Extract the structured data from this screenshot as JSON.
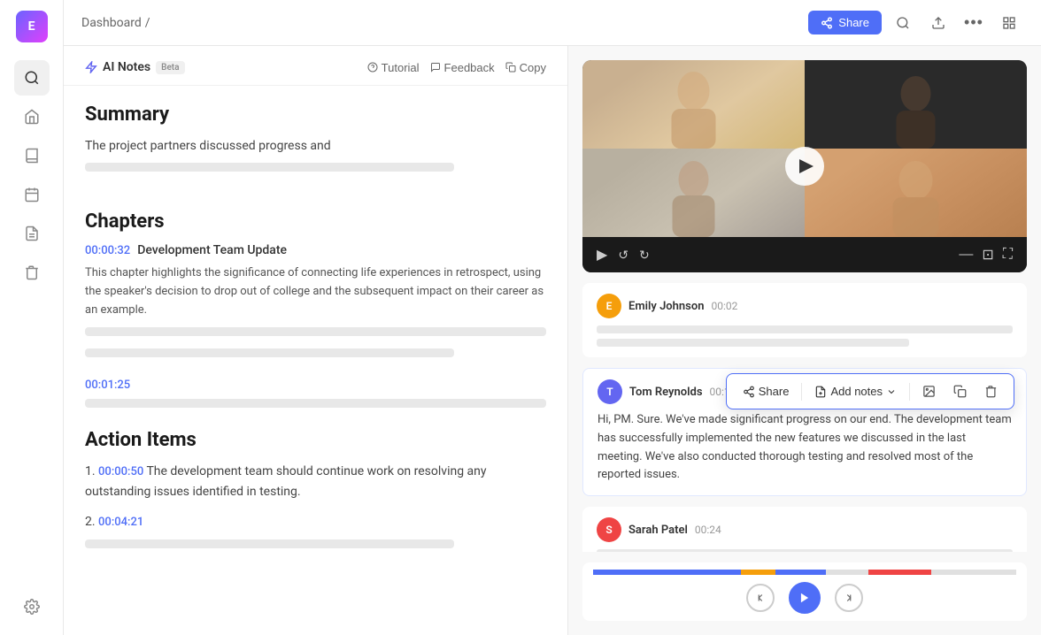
{
  "app": {
    "logo_text": "E"
  },
  "breadcrumb": {
    "text": "Dashboard",
    "separator": "/"
  },
  "topbar": {
    "share_label": "Share",
    "search_tooltip": "Search",
    "upload_tooltip": "Upload",
    "more_tooltip": "More",
    "layout_tooltip": "Layout"
  },
  "notes_panel": {
    "title": "AI Notes",
    "beta_label": "Beta",
    "tutorial_label": "Tutorial",
    "feedback_label": "Feedback",
    "copy_label": "Copy",
    "summary_title": "Summary",
    "summary_text": "The  project partners discussed progress and",
    "chapters_title": "Chapters",
    "chapter1": {
      "timestamp": "00:00:32",
      "title": "Development Team Update",
      "description": "This chapter highlights the significance of connecting life experiences in retrospect, using the speaker's decision to drop out of college and the subsequent impact on their career as an example."
    },
    "chapter2": {
      "timestamp": "00:01:25"
    },
    "action_items_title": "Action Items",
    "action1_timestamp": "00:00:50",
    "action1_text": "The development team should continue work on resolving any outstanding issues identified in testing.",
    "action2_timestamp": "00:04:21"
  },
  "comments": [
    {
      "name": "Emily Johnson",
      "time": "00:02",
      "avatar_color": "#f59e0b",
      "avatar_initial": "E",
      "has_text": false
    },
    {
      "name": "Tom Reynolds",
      "time": "00:11",
      "avatar_color": "#6366f1",
      "avatar_initial": "T",
      "text": "Hi, PM. Sure. We've made significant progress on our end. The development team has successfully implemented the new features we discussed in the last meeting. We've also conducted thorough testing and resolved most of the reported issues."
    },
    {
      "name": "Sarah Patel",
      "time": "00:24",
      "avatar_color": "#ef4444",
      "avatar_initial": "S",
      "has_text": false
    }
  ],
  "action_toolbar": {
    "share_label": "Share",
    "add_notes_label": "Add notes",
    "image_tooltip": "Image",
    "copy_tooltip": "Copy",
    "delete_tooltip": "Delete"
  },
  "progress_segments": [
    {
      "color": "#4f6ef7",
      "width": "35%"
    },
    {
      "color": "#f59e0b",
      "width": "8%"
    },
    {
      "color": "#4f6ef7",
      "width": "12%"
    },
    {
      "color": "#e8e8e8",
      "width": "10%"
    },
    {
      "color": "#ef4444",
      "width": "15%"
    },
    {
      "color": "#e8e8e8",
      "width": "20%"
    }
  ]
}
